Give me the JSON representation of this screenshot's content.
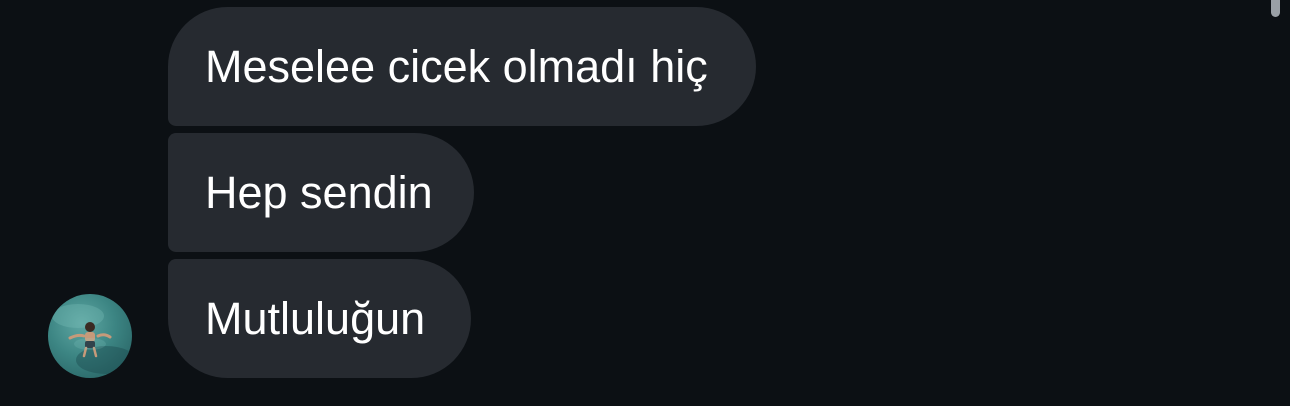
{
  "messages": [
    {
      "text": "Meselee cicek olmadı hiç"
    },
    {
      "text": "Hep sendin"
    },
    {
      "text": "Mutluluğun"
    }
  ],
  "colors": {
    "background": "#0c1014",
    "bubble": "#262a30",
    "text": "#ffffff"
  },
  "avatar": {
    "icon": "profile-avatar-photo"
  }
}
